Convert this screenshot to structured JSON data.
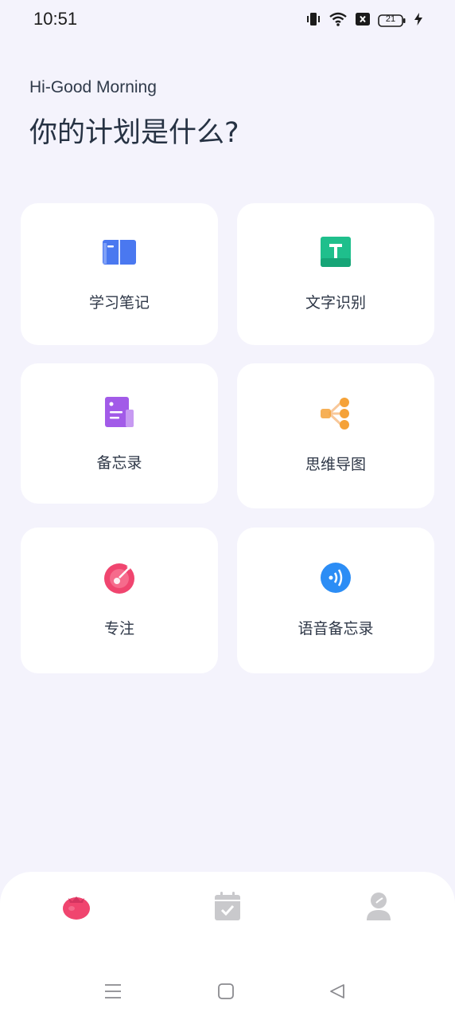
{
  "status_bar": {
    "time": "10:51",
    "battery_level": "21",
    "icons": [
      "vibrate-icon",
      "wifi-icon",
      "sim-blocked-icon",
      "battery-icon",
      "charging-icon"
    ]
  },
  "header": {
    "greeting": "Hi-Good Morning",
    "title": "你的计划是什么?"
  },
  "cards": [
    {
      "label": "学习笔记",
      "icon": "notebook-icon",
      "color": "#4a78f0"
    },
    {
      "label": "文字识别",
      "icon": "text-recognition-icon",
      "color": "#1fbf8c"
    },
    {
      "label": "备忘录",
      "icon": "memo-icon",
      "color": "#a25be8"
    },
    {
      "label": "思维导图",
      "icon": "mind-map-icon",
      "color": "#f5a238"
    },
    {
      "label": "专注",
      "icon": "focus-icon",
      "color": "#f0456f"
    },
    {
      "label": "语音备忘录",
      "icon": "voice-memo-icon",
      "color": "#2c8df5"
    }
  ],
  "bottom_nav": {
    "items": [
      "tomato-icon",
      "calendar-check-icon",
      "profile-icon"
    ],
    "active_color": "#f0456f",
    "inactive_color": "#c9c9cc"
  },
  "system_nav": [
    "menu-icon",
    "home-icon",
    "back-icon"
  ]
}
